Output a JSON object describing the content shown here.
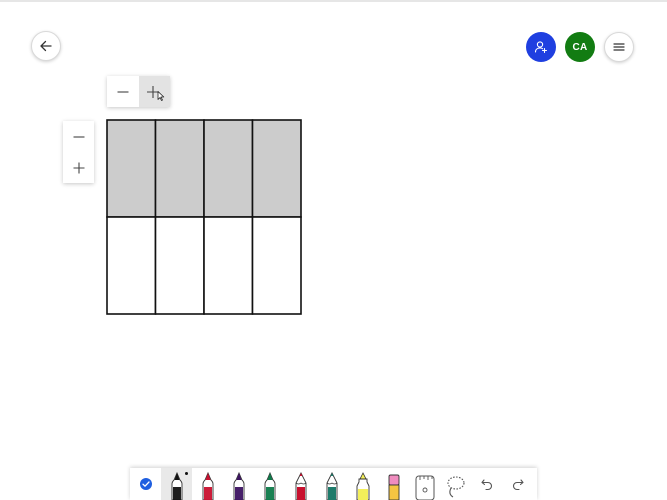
{
  "header": {
    "back_icon": "arrow-left-icon",
    "share_icon": "add-person-icon",
    "avatar_initials": "CA",
    "menu_icon": "hamburger-icon",
    "colors": {
      "share": "#1f3fe0",
      "avatar": "#127c12"
    }
  },
  "grid": {
    "columns": 4,
    "rows": 2,
    "shaded_rows": [
      0
    ],
    "shade_color": "#cccccc"
  },
  "column_stepper": {
    "decrease_icon": "minus-icon",
    "increase_icon": "plus-icon",
    "hovered": "increase"
  },
  "row_stepper": {
    "decrease_icon": "minus-icon",
    "increase_icon": "plus-icon"
  },
  "toolbar": {
    "tools": [
      {
        "icon": "check-circle-icon",
        "color": "#1f5fe0"
      },
      {
        "icon": "pen-icon",
        "color": "#111111",
        "selected": true
      },
      {
        "icon": "pen-icon",
        "color": "#c8102e"
      },
      {
        "icon": "pen-icon",
        "color": "#3c1361"
      },
      {
        "icon": "pen-icon",
        "color": "#0e7a4a"
      },
      {
        "icon": "pencil-icon",
        "color": "#c8102e"
      },
      {
        "icon": "pencil-icon",
        "color": "#1e7b6b"
      },
      {
        "icon": "highlighter-icon",
        "color": "#f3ef5a"
      },
      {
        "icon": "eraser-icon",
        "color": "#f08cbf"
      },
      {
        "icon": "ruler-icon",
        "color": "#555555"
      },
      {
        "icon": "lasso-icon",
        "color": "#555555"
      },
      {
        "icon": "undo-icon",
        "color": "#555555"
      },
      {
        "icon": "redo-icon",
        "color": "#555555"
      }
    ]
  }
}
